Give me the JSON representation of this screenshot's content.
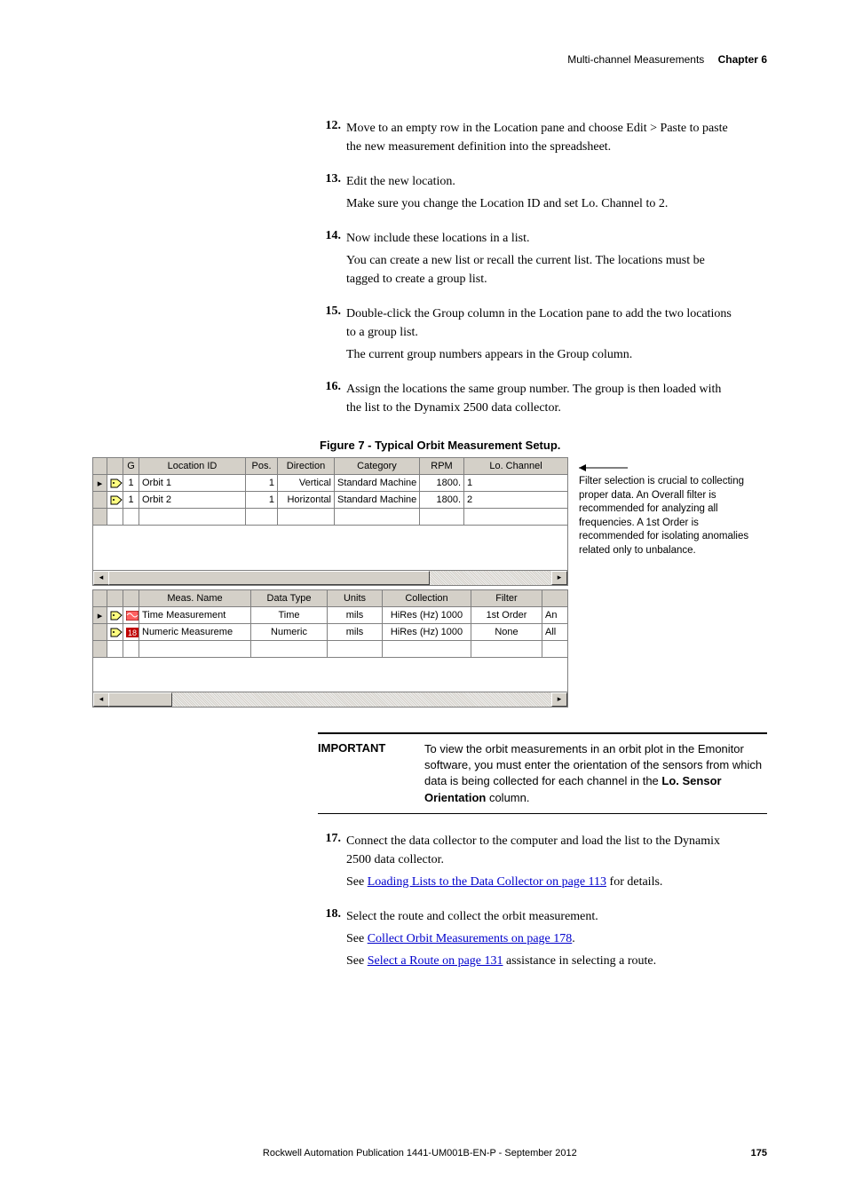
{
  "header": {
    "section": "Multi-channel Measurements",
    "chapter": "Chapter 6"
  },
  "steps": [
    {
      "n": "12.",
      "body": "Move to an empty row in the Location pane and choose Edit > Paste to paste the new measurement definition into the spreadsheet.",
      "extra": []
    },
    {
      "n": "13.",
      "body": "Edit the new location.",
      "extra": [
        "Make sure you change the Location ID and set Lo. Channel to 2."
      ]
    },
    {
      "n": "14.",
      "body": "Now include these locations in a list.",
      "extra": [
        "You can create a new list or recall the current list. The locations must be tagged to create a group list."
      ]
    },
    {
      "n": "15.",
      "body": "Double-click the Group column in the Location pane to add the two locations to a group list.",
      "extra": [
        "The current group numbers appears in the Group column."
      ]
    },
    {
      "n": "16.",
      "body": "Assign the locations the same group number. The group is then loaded with the list to the Dynamix 2500 data collector.",
      "extra": []
    }
  ],
  "figcaption": "Figure 7 - Typical Orbit Measurement Setup",
  "locTable": {
    "headers": [
      "",
      "",
      "G",
      "Location ID",
      "Pos.",
      "Direction",
      "Category",
      "RPM",
      "Lo. Channel"
    ],
    "rows": [
      {
        "sel": true,
        "g": "1",
        "id": "Orbit 1",
        "pos": "1",
        "dir": "Vertical",
        "cat": "Standard Machine",
        "rpm": "1800.",
        "ch": "1"
      },
      {
        "sel": false,
        "g": "1",
        "id": "Orbit 2",
        "pos": "1",
        "dir": "Horizontal",
        "cat": "Standard Machine",
        "rpm": "1800.",
        "ch": "2"
      }
    ]
  },
  "measTable": {
    "headers": [
      "",
      "",
      "",
      "Meas. Name",
      "Data Type",
      "Units",
      "Collection",
      "Filter",
      ""
    ],
    "rows": [
      {
        "sel": true,
        "name": "Time Measurement",
        "type": "Time",
        "units": "mils",
        "coll": "HiRes (Hz) 1000",
        "filter": "1st Order",
        "x": "An"
      },
      {
        "sel": false,
        "name": "Numeric Measureme",
        "type": "Numeric",
        "units": "mils",
        "coll": "HiRes (Hz) 1000",
        "filter": "None",
        "x": "All"
      }
    ]
  },
  "sidenote": "Filter selection is crucial to collecting proper data. An Overall filter is recommended for analyzing all frequencies. A 1st Order is recommended for isolating anomalies related only to unbalance.",
  "important": {
    "label": "IMPORTANT",
    "text1": "To view the orbit measurements in an orbit plot in the Emonitor software, you must enter the orientation of the sensors from which data is being collected for each channel in the ",
    "bold": "Lo. Sensor Orientation",
    "text2": " column."
  },
  "steps2": [
    {
      "n": "17.",
      "body": "Connect the data collector to the computer and load the list to the Dynamix 2500 data collector.",
      "see": "See ",
      "link": "Loading Lists to the Data Collector on page 113",
      "after": " for details."
    },
    {
      "n": "18.",
      "body": "Select the route and collect the orbit measurement.",
      "lines": [
        {
          "see": "See ",
          "link": "Collect Orbit Measurements on page 178",
          "after": "."
        },
        {
          "see": "See ",
          "link": "Select a Route on page 131",
          "after": " assistance in selecting a route."
        }
      ]
    }
  ],
  "footer": {
    "pub": "Rockwell Automation Publication 1441-UM001B-EN-P - September 2012",
    "page": "175"
  }
}
